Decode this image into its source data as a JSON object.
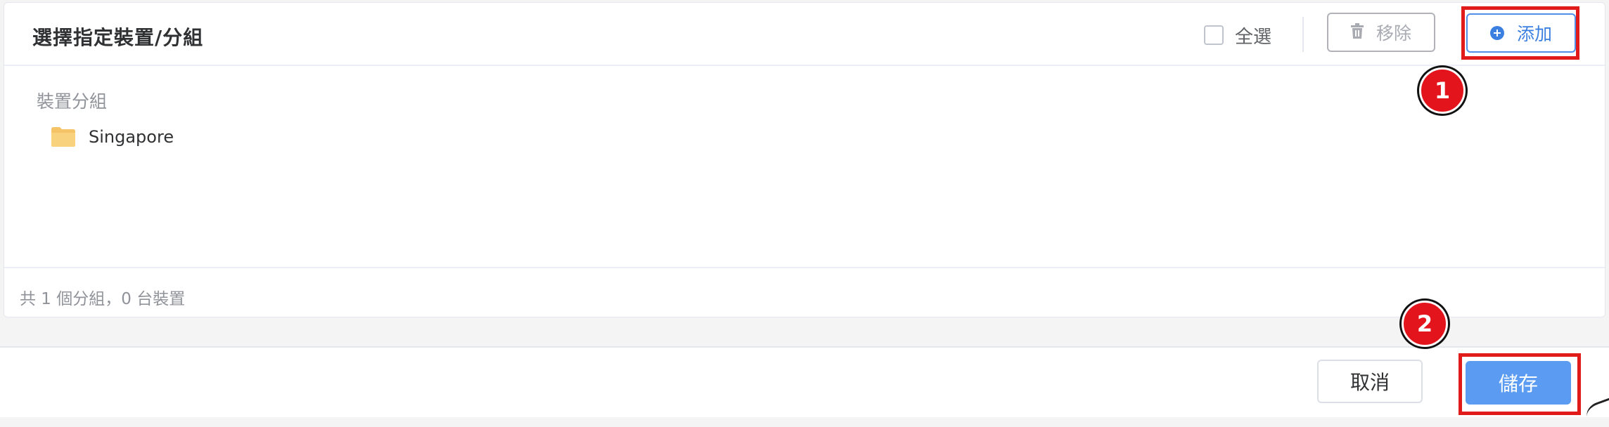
{
  "header": {
    "title": "選擇指定裝置/分組",
    "select_all_label": "全選",
    "remove_label": "移除",
    "add_label": "添加"
  },
  "content": {
    "section_label": "裝置分組",
    "groups": [
      {
        "name": "Singapore",
        "icon": "folder-icon"
      }
    ]
  },
  "footer": {
    "summary": "共 1 個分組，0 台裝置"
  },
  "actions": {
    "cancel_label": "取消",
    "save_label": "儲存"
  },
  "annotations": {
    "step1": "1",
    "step2": "2",
    "highlight_color": "#e11a1a",
    "badge_color": "#e3141c"
  },
  "colors": {
    "accent": "#3b7fe0",
    "save_button": "#5b9cf2",
    "folder": "#f5c466"
  }
}
